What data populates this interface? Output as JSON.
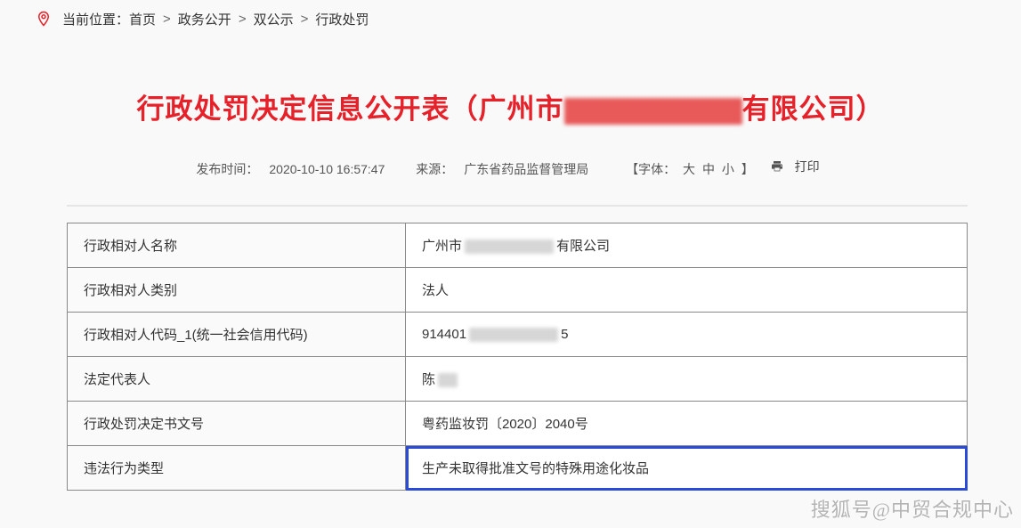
{
  "breadcrumb": {
    "label": "当前位置：",
    "items": [
      "首页",
      "政务公开",
      "双公示",
      "行政处罚"
    ]
  },
  "title": {
    "prefix": "行政处罚决定信息公开表（广州市",
    "suffix": "有限公司）"
  },
  "meta": {
    "publish_label": "发布时间：",
    "publish_value": "2020-10-10 16:57:47",
    "source_label": "来源：",
    "source_value": "广东省药品监督管理局",
    "font_label": "【字体：",
    "font_large": "大",
    "font_medium": "中",
    "font_small": "小",
    "font_close": "】",
    "print": "打印"
  },
  "table": {
    "rows": [
      {
        "label": "行政相对人名称",
        "value_prefix": "广州市",
        "value_suffix": "有限公司",
        "redacted": true
      },
      {
        "label": "行政相对人类别",
        "value": "法人"
      },
      {
        "label": "行政相对人代码_1(统一社会信用代码)",
        "value_prefix": "914401",
        "value_suffix": "5",
        "redacted": true
      },
      {
        "label": "法定代表人",
        "value_prefix": "陈",
        "value_suffix": "",
        "redacted": true,
        "redact_short": true
      },
      {
        "label": "行政处罚决定书文号",
        "value": "粤药监妆罚〔2020〕2040号"
      },
      {
        "label": "违法行为类型",
        "value": "生产未取得批准文号的特殊用途化妆品",
        "highlight": true
      }
    ]
  },
  "watermark": "搜狐号@中贸合规中心"
}
